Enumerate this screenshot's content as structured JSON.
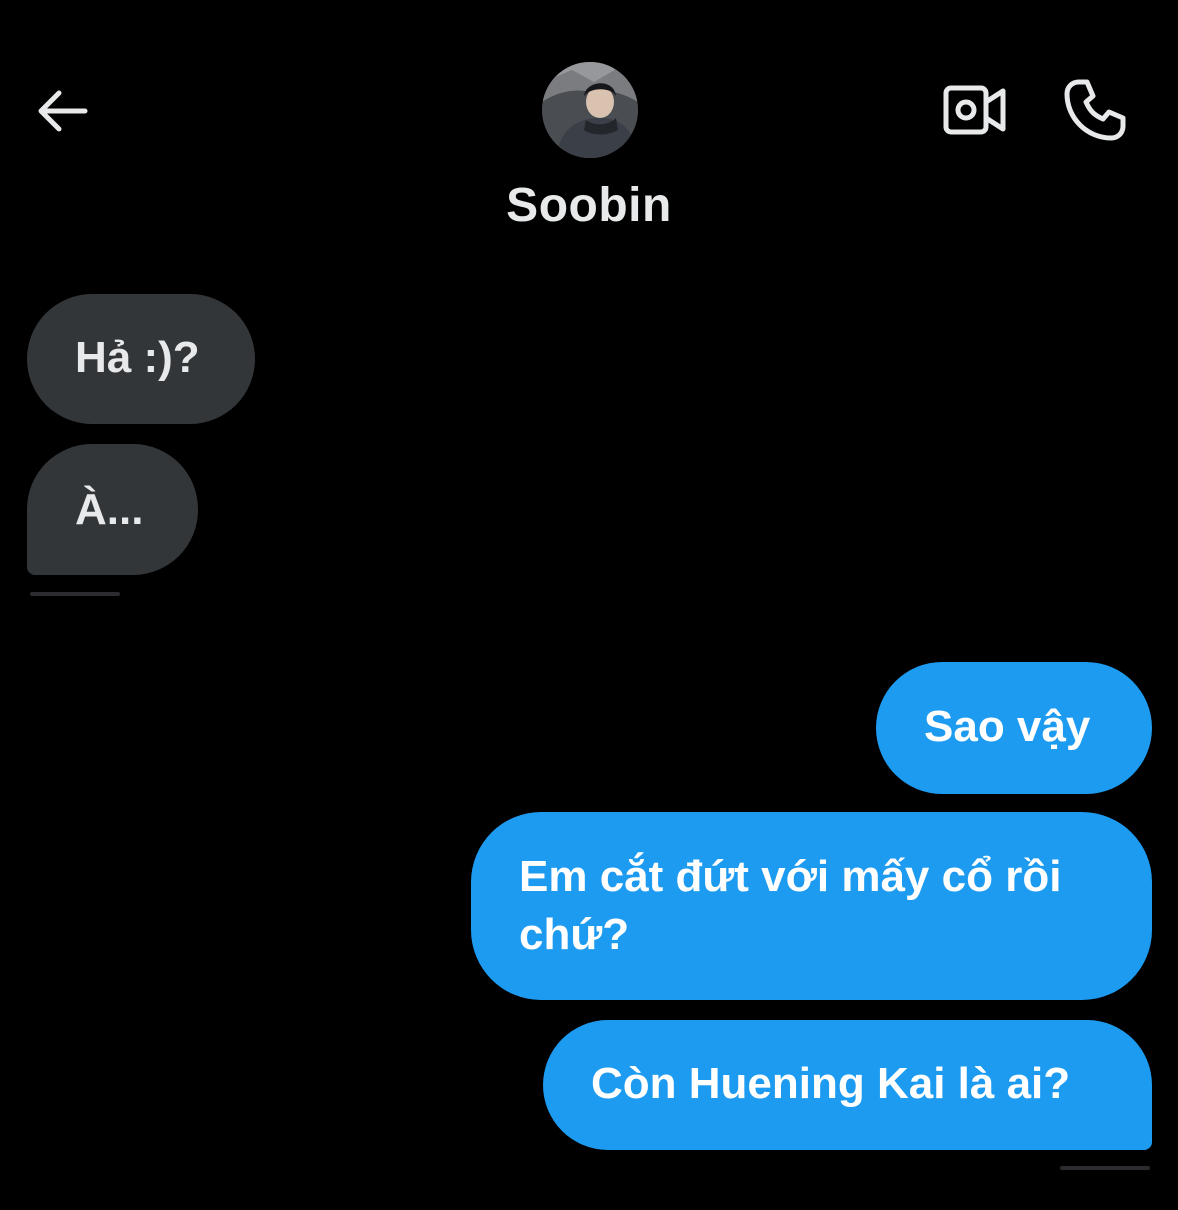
{
  "header": {
    "back_icon": "arrow-left-icon",
    "contact_name": "Soobin",
    "video_icon": "video-camera-icon",
    "call_icon": "phone-icon"
  },
  "messages": [
    {
      "direction": "incoming",
      "text": "Hả :)?"
    },
    {
      "direction": "incoming",
      "text": "À..."
    },
    {
      "direction": "outgoing",
      "text": "Sao vậy"
    },
    {
      "direction": "outgoing",
      "text": "Em cắt đứt với mấy cổ rồi chứ?"
    },
    {
      "direction": "outgoing",
      "text": "Còn Huening Kai là ai?"
    }
  ],
  "colors": {
    "background": "#000000",
    "incoming_bubble": "#333639",
    "outgoing_bubble": "#1d9bf0",
    "text": "#e7e9ea"
  }
}
